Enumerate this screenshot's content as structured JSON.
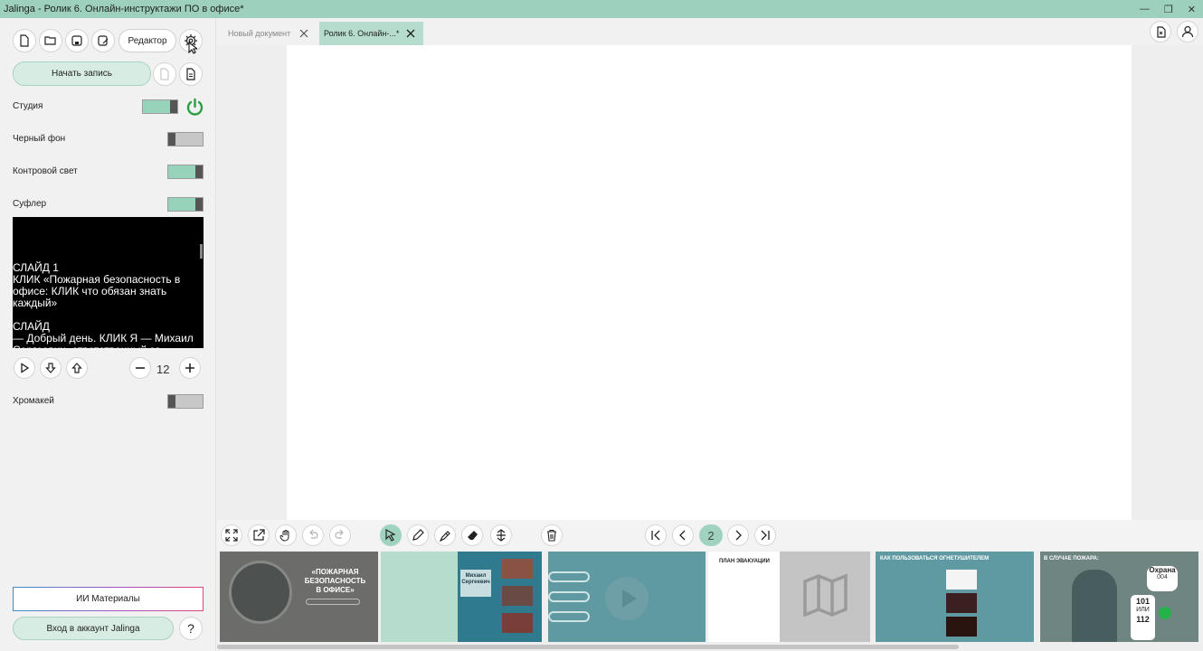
{
  "window": {
    "title": "Jalinga - Ролик 6. Онлайн-инструктажи ПО в офисе*",
    "buttons": [
      "minimize-icon",
      "restore-icon",
      "close-icon"
    ]
  },
  "sidebar": {
    "top_icons": [
      "new-file-icon",
      "open-folder-icon",
      "save-icon",
      "save-as-icon"
    ],
    "editor_label": "Редактор",
    "start_record_label": "Начать запись",
    "toggles": [
      {
        "label": "Студия",
        "on": true
      },
      {
        "label": "Черный фон",
        "on": false
      },
      {
        "label": "Контровой свет",
        "on": true
      },
      {
        "label": "Суфлер",
        "on": true
      }
    ],
    "power_color": "#2e9e44",
    "prompter_text": "СЛАЙД 1\nКЛИК «Пожарная безопасность в офисе: КЛИК что обязан знать каждый»\n\nСЛАЙД\n— Добрый день. КЛИК Я — Михаил\nСергеевич, ответственный за",
    "font_size_value": "12",
    "chromakey_label": "Хромакей",
    "chromakey_on": false,
    "ai_materials_label": "ИИ Материалы",
    "login_label": "Вход в аккаунт Jalinga",
    "help_label": "?"
  },
  "tabs": [
    {
      "label": "Новый документ",
      "active": false
    },
    {
      "label": "Ролик 6. Онлайн-...*",
      "active": true
    }
  ],
  "toolbar": {
    "page_number": "2"
  },
  "thumbnails": {
    "slide1_title": "«ПОЖАРНАЯ БЕЗОПАСНОСТЬ В ОФИСЕ»",
    "slide2_name": "Михаил Сергеевич",
    "slide4_title": "ПЛАН ЭВАКУАЦИИ",
    "slide5_title": "КАК ПОЛЬЗОВАТЬСЯ ОГНЕТУШИТЕЛЕМ",
    "slide6_title": "В СЛУЧАЕ ПОЖАРА:",
    "slide6_security": "Охрана",
    "slide6_security_num": "004",
    "slide6_num1": "101",
    "slide6_or": "ИЛИ",
    "slide6_num2": "112"
  },
  "colors": {
    "accent": "#9fd3bf",
    "slide_teal": "#5f9aa3"
  }
}
